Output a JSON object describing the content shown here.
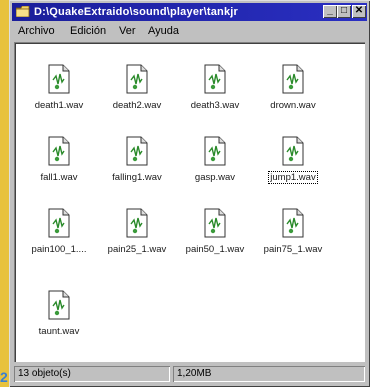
{
  "window": {
    "title": "D:\\QuakeExtraido\\sound\\player\\tankjr",
    "minimize_label": "_",
    "maximize_label": "□",
    "close_label": "✕"
  },
  "menubar": {
    "items": [
      {
        "label": "Archivo"
      },
      {
        "label": "Edición"
      },
      {
        "label": "Ver"
      },
      {
        "label": "Ayuda"
      }
    ]
  },
  "files": [
    {
      "name": "death1.wav",
      "icon": "wav-file-icon"
    },
    {
      "name": "death2.wav",
      "icon": "wav-file-icon"
    },
    {
      "name": "death3.wav",
      "icon": "wav-file-icon"
    },
    {
      "name": "drown.wav",
      "icon": "wav-file-icon"
    },
    {
      "name": "fall1.wav",
      "icon": "wav-file-icon"
    },
    {
      "name": "falling1.wav",
      "icon": "wav-file-icon"
    },
    {
      "name": "gasp.wav",
      "icon": "wav-file-icon"
    },
    {
      "name": "jump1.wav",
      "icon": "wav-file-icon",
      "focused": true
    },
    {
      "name": "pain100_1....",
      "icon": "wav-file-icon"
    },
    {
      "name": "pain25_1.wav",
      "icon": "wav-file-icon"
    },
    {
      "name": "pain50_1.wav",
      "icon": "wav-file-icon"
    },
    {
      "name": "pain75_1.wav",
      "icon": "wav-file-icon"
    },
    {
      "name": "taunt.wav",
      "icon": "wav-file-icon"
    }
  ],
  "statusbar": {
    "object_count": "13 objeto(s)",
    "total_size": "1,20MB"
  },
  "page_number": "2",
  "colors": {
    "titlebar": "#1a1e9a",
    "window_face": "#c0c0c0",
    "background": "#f4d25a",
    "page_number": "#3a7fd0"
  }
}
